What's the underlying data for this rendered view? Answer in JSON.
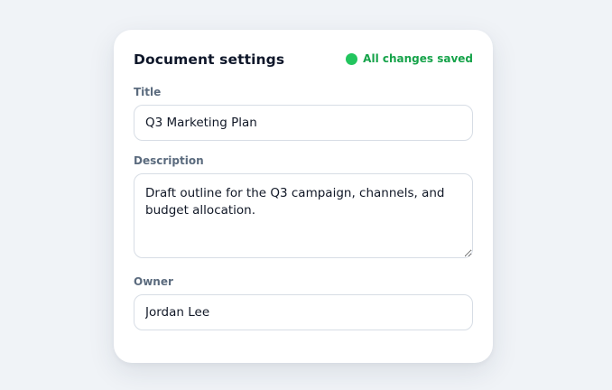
{
  "panel": {
    "title": "Document settings",
    "status": {
      "text": "All changes saved",
      "color": "#22c55e",
      "icon": "status-dot-icon"
    }
  },
  "fields": {
    "title": {
      "label": "Title",
      "value": "Q3 Marketing Plan"
    },
    "description": {
      "label": "Description",
      "value": "Draft outline for the Q3 campaign, channels, and budget allocation."
    },
    "owner": {
      "label": "Owner",
      "value": "Jordan Lee"
    }
  }
}
